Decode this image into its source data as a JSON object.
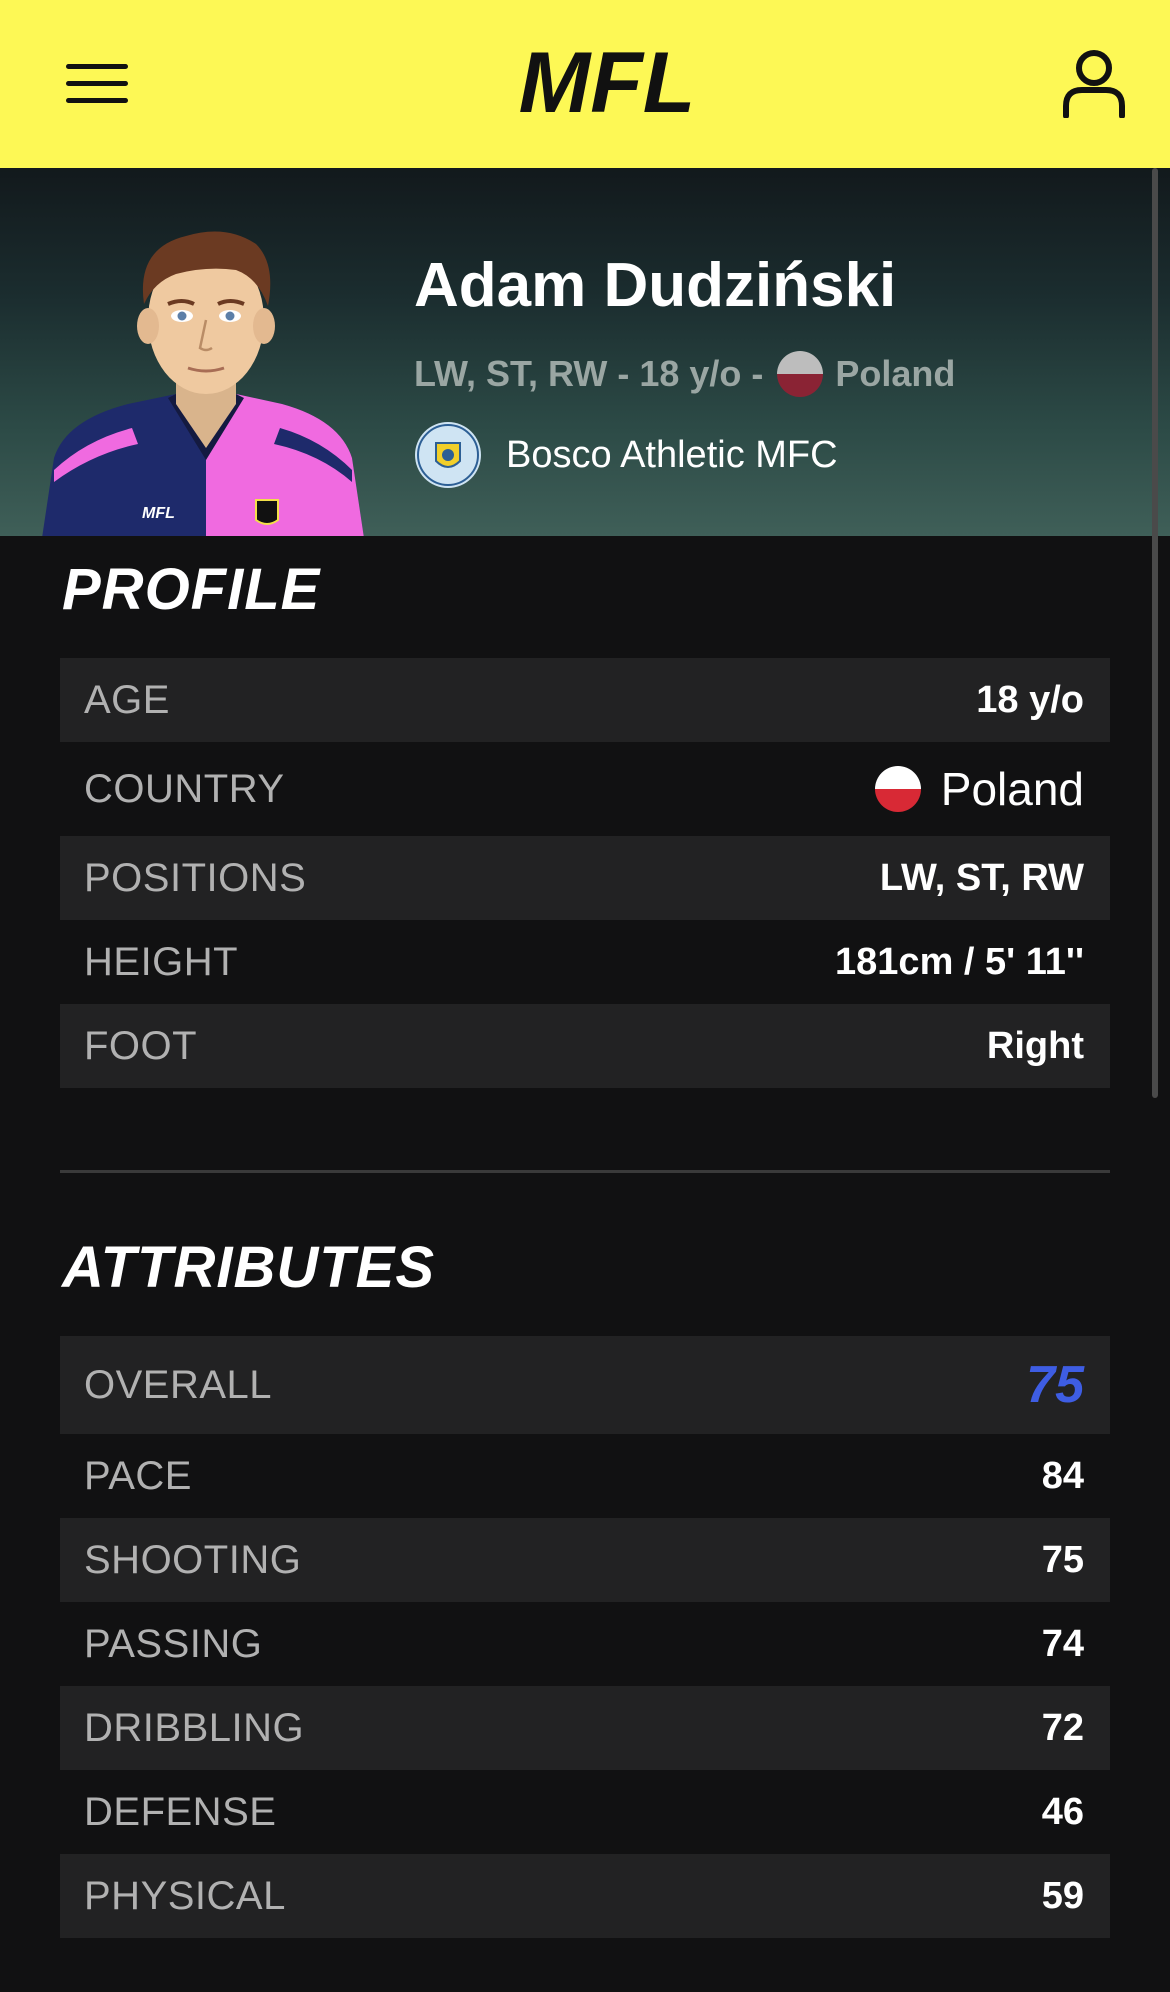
{
  "header": {
    "logo_text": "MFL",
    "menu_icon": "hamburger-menu-icon",
    "user_icon": "user-icon",
    "background": "#fdf855"
  },
  "player": {
    "name": "Adam Dudziński",
    "summary_positions": "LW, ST, RW - 18 y/o -",
    "country": "Poland",
    "club": "Bosco Athletic MFC",
    "club_badge_text": "BOSCO ATHLETIC METAVERSE FC",
    "jersey_text": "MFL"
  },
  "profile": {
    "title": "PROFILE",
    "rows": [
      {
        "label": "AGE",
        "value": "18 y/o"
      },
      {
        "label": "COUNTRY",
        "value": "Poland"
      },
      {
        "label": "POSITIONS",
        "value": "LW, ST, RW"
      },
      {
        "label": "HEIGHT",
        "value": "181cm / 5' 11''"
      },
      {
        "label": "FOOT",
        "value": "Right"
      }
    ]
  },
  "attributes": {
    "title": "ATTRIBUTES",
    "overall": {
      "label": "OVERALL",
      "value": "75",
      "color": "#3e5de3"
    },
    "rows": [
      {
        "label": "PACE",
        "value": "84"
      },
      {
        "label": "SHOOTING",
        "value": "75"
      },
      {
        "label": "PASSING",
        "value": "74"
      },
      {
        "label": "DRIBBLING",
        "value": "72"
      },
      {
        "label": "DEFENSE",
        "value": "46"
      },
      {
        "label": "PHYSICAL",
        "value": "59"
      }
    ]
  }
}
